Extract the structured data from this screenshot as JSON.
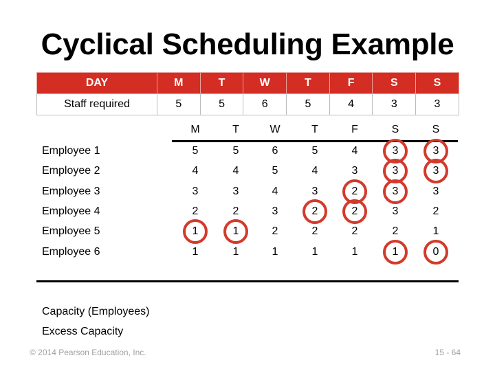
{
  "title": "Cyclical Scheduling Example",
  "requirements": {
    "header_label": "DAY",
    "days": [
      "M",
      "T",
      "W",
      "T",
      "F",
      "S",
      "S"
    ],
    "row_label": "Staff required",
    "values": [
      5,
      5,
      6,
      5,
      4,
      3,
      3
    ]
  },
  "schedule": {
    "days": [
      "M",
      "T",
      "W",
      "T",
      "F",
      "S",
      "S"
    ],
    "rows": [
      {
        "label": "Employee 1",
        "values": [
          5,
          5,
          6,
          5,
          4,
          3,
          3
        ],
        "circled": [
          false,
          false,
          false,
          false,
          false,
          true,
          true
        ]
      },
      {
        "label": "Employee 2",
        "values": [
          4,
          4,
          5,
          4,
          3,
          3,
          3
        ],
        "circled": [
          false,
          false,
          false,
          false,
          false,
          true,
          true
        ]
      },
      {
        "label": "Employee 3",
        "values": [
          3,
          3,
          4,
          3,
          2,
          3,
          3
        ],
        "circled": [
          false,
          false,
          false,
          false,
          true,
          true,
          false
        ]
      },
      {
        "label": "Employee 4",
        "values": [
          2,
          2,
          3,
          2,
          2,
          3,
          2
        ],
        "circled": [
          false,
          false,
          false,
          true,
          true,
          false,
          false
        ]
      },
      {
        "label": "Employee 5",
        "values": [
          1,
          1,
          2,
          2,
          2,
          2,
          1
        ],
        "circled": [
          true,
          true,
          false,
          false,
          false,
          false,
          false
        ]
      },
      {
        "label": "Employee 6",
        "values": [
          1,
          1,
          1,
          1,
          1,
          1,
          0
        ],
        "circled": [
          false,
          false,
          false,
          false,
          false,
          true,
          true
        ]
      }
    ],
    "capacity_label": "Capacity (Employees)",
    "excess_label": "Excess Capacity"
  },
  "colors": {
    "accent": "#d42d23",
    "circle": "#d33a2c"
  },
  "footer": {
    "copyright": "© 2014 Pearson Education, Inc.",
    "page": "15 - 64"
  }
}
